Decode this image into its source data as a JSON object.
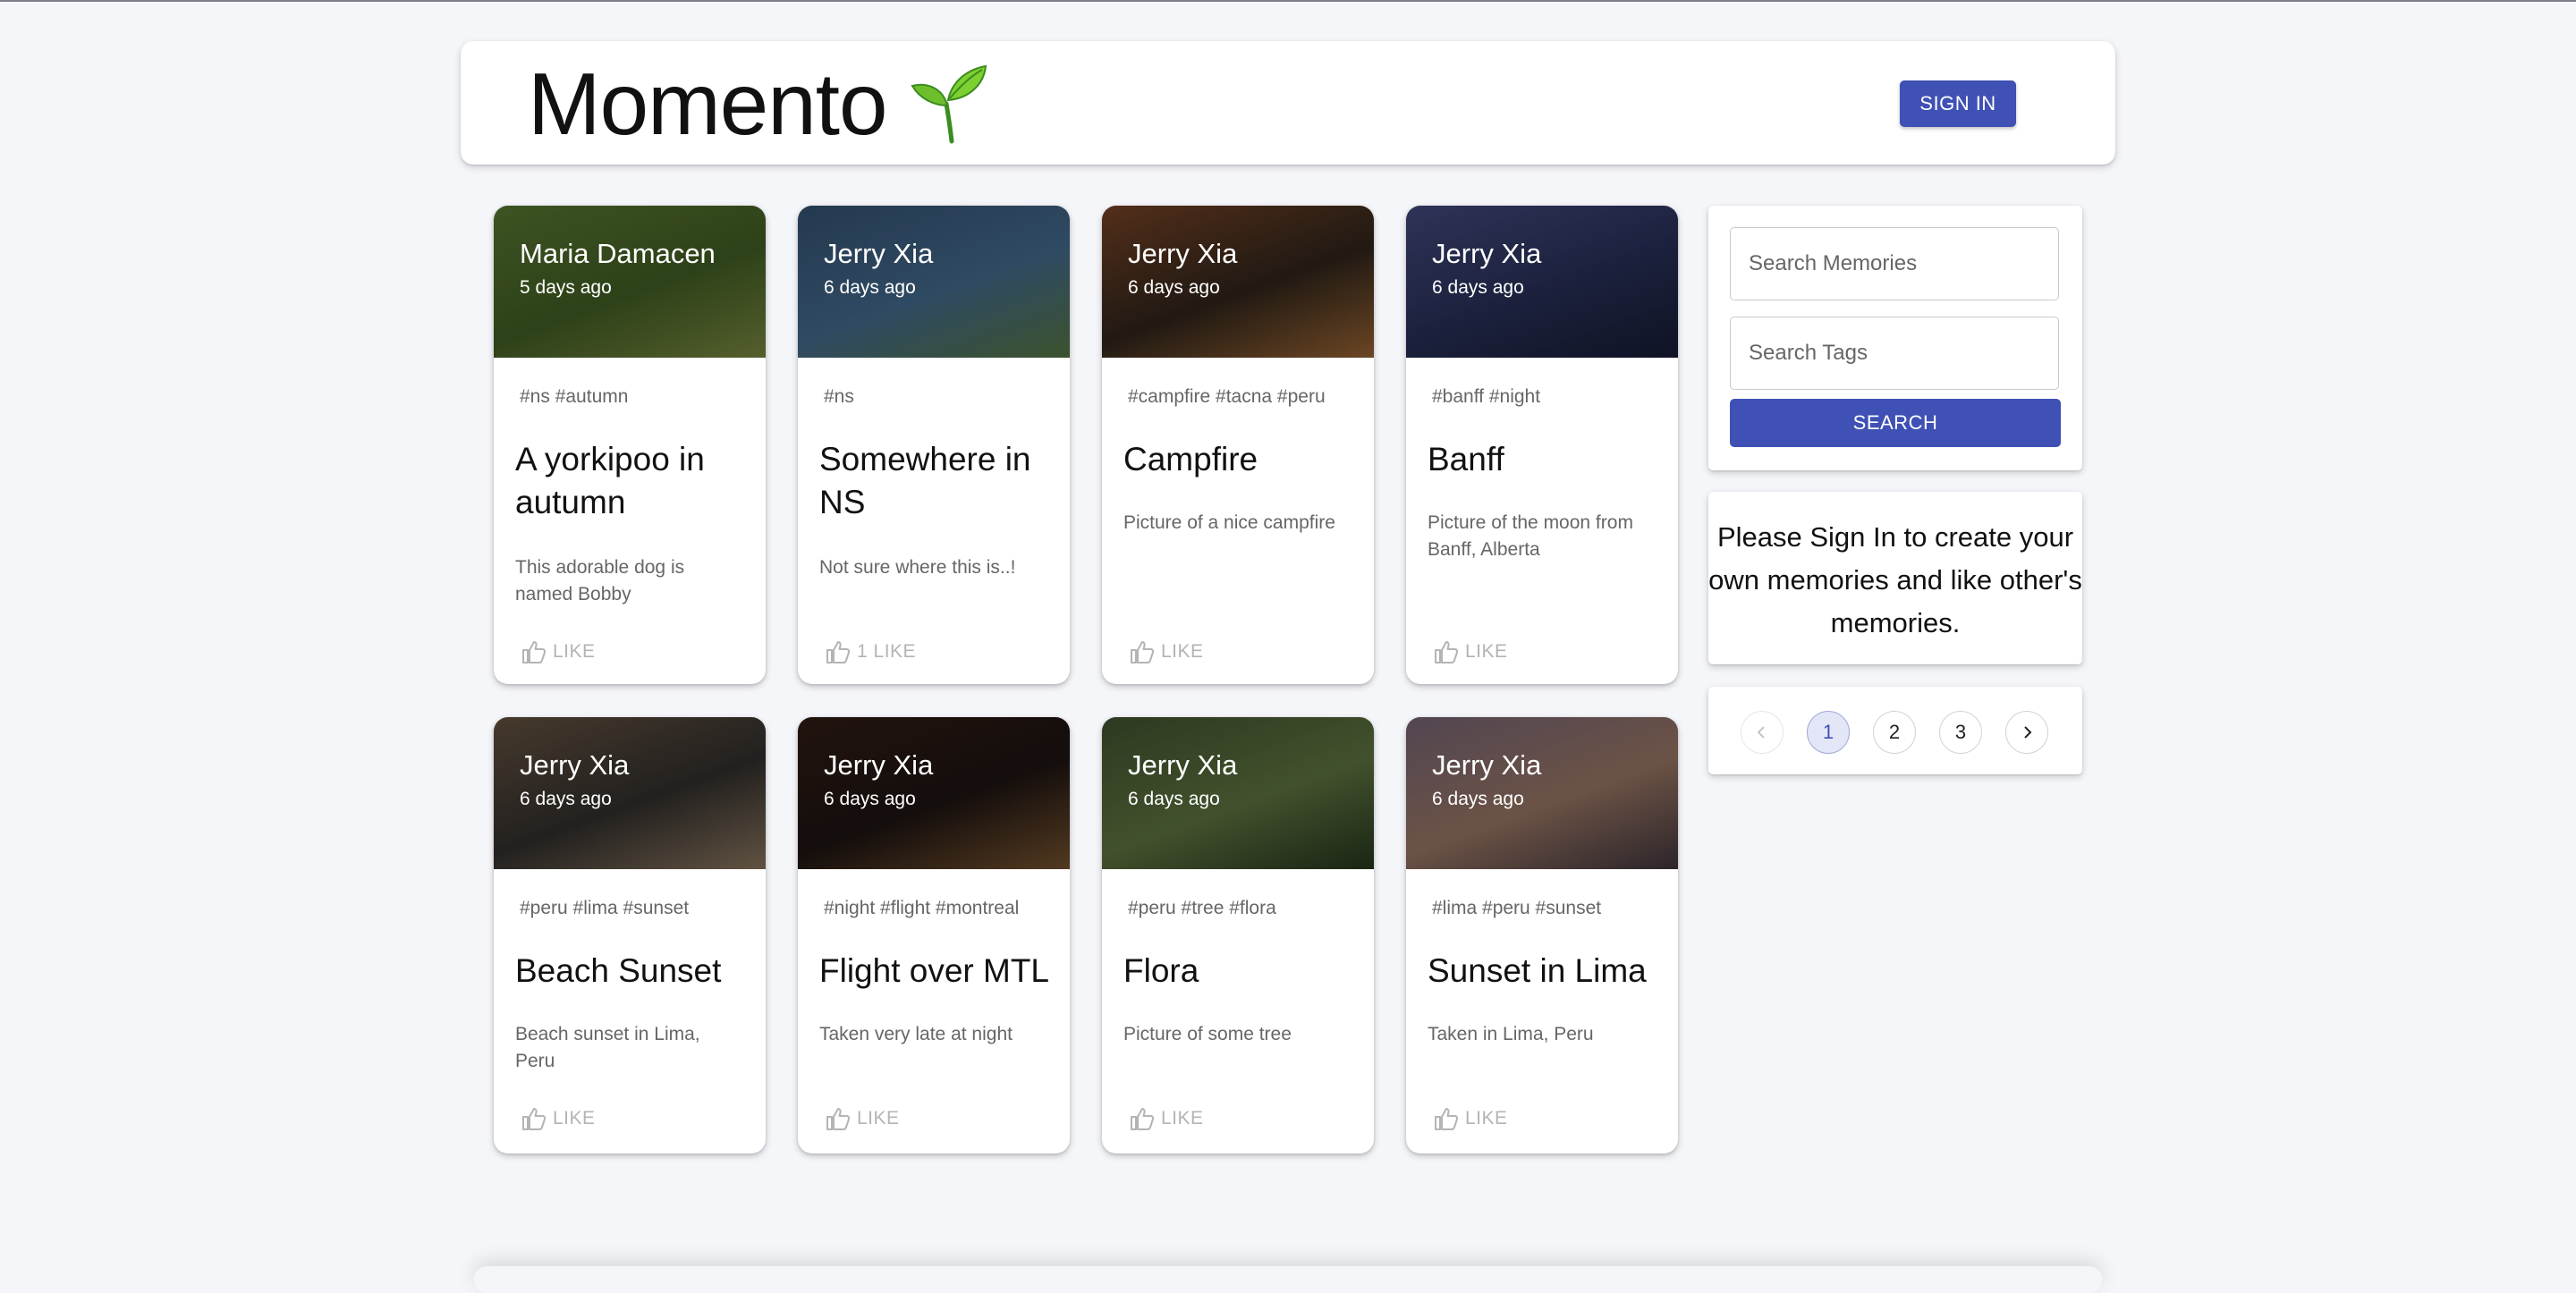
{
  "header": {
    "brand": "Momento",
    "signin_label": "SIGN IN"
  },
  "posts": [
    {
      "author": "Maria Damacen",
      "ago": "5 days ago",
      "tags": "#ns #autumn",
      "title": "A yorkipoo in autumn",
      "desc": "This adorable dog is named Bobby",
      "like": "LIKE",
      "colors": [
        "#4f6b2c",
        "#3b5420",
        "#6d7a3a"
      ]
    },
    {
      "author": "Jerry Xia",
      "ago": "6 days ago",
      "tags": "#ns",
      "title": "Somewhere in NS",
      "desc": "Not sure where this is..!",
      "like": "1 LIKE",
      "colors": [
        "#2f4a66",
        "#3d5f7f",
        "#4c6a3a"
      ]
    },
    {
      "author": "Jerry Xia",
      "ago": "6 days ago",
      "tags": "#campfire #tacna #peru",
      "title": "Campfire",
      "desc": "Picture of a nice campfire",
      "like": "LIKE",
      "colors": [
        "#6a3c22",
        "#2b2118",
        "#8a5a2e"
      ]
    },
    {
      "author": "Jerry Xia",
      "ago": "6 days ago",
      "tags": "#banff #night",
      "title": "Banff",
      "desc": "Picture of the moon from Banff, Alberta",
      "like": "LIKE",
      "colors": [
        "#3c4371",
        "#232a4e",
        "#15192f"
      ]
    },
    {
      "author": "Jerry Xia",
      "ago": "6 days ago",
      "tags": "#peru #lima #sunset",
      "title": "Beach Sunset",
      "desc": "Beach sunset in Lima, Peru",
      "like": "LIKE",
      "colors": [
        "#5a4a3a",
        "#2d2a28",
        "#7c6a55"
      ]
    },
    {
      "author": "Jerry Xia",
      "ago": "6 days ago",
      "tags": "#night #flight #montreal",
      "title": "Flight over MTL",
      "desc": "Taken very late at night",
      "like": "LIKE",
      "colors": [
        "#2b1a12",
        "#1a1210",
        "#6a4a2a"
      ]
    },
    {
      "author": "Jerry Xia",
      "ago": "6 days ago",
      "tags": "#peru #tree #flora",
      "title": "Flora",
      "desc": "Picture of some tree",
      "like": "LIKE",
      "colors": [
        "#3a4a2a",
        "#55683a",
        "#22301a"
      ]
    },
    {
      "author": "Jerry Xia",
      "ago": "6 days ago",
      "tags": "#lima #peru #sunset",
      "title": "Sunset in Lima",
      "desc": "Taken in Lima, Peru",
      "like": "LIKE",
      "colors": [
        "#6a5a6a",
        "#8a6a5a",
        "#3a3036"
      ]
    }
  ],
  "search": {
    "memories_placeholder": "Search Memories",
    "tags_placeholder": "Search Tags",
    "button_label": "SEARCH"
  },
  "notice": "Please Sign In to create your own memories and like other's memories.",
  "pagination": {
    "pages": [
      "1",
      "2",
      "3"
    ],
    "current": "1"
  }
}
